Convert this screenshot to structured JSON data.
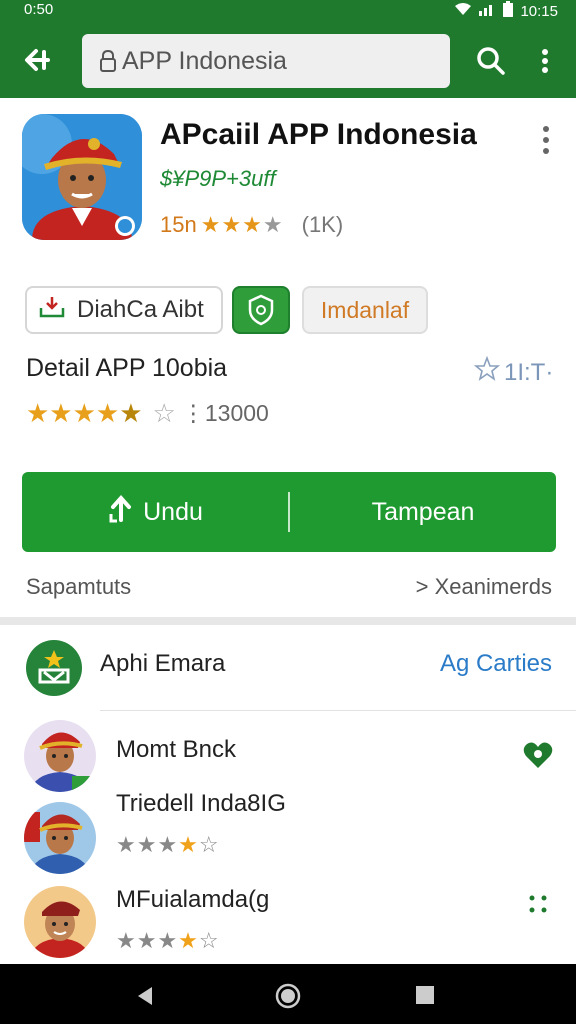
{
  "status_bar": {
    "time": "0:50",
    "right_text": "10:15"
  },
  "search": {
    "value": "APP Indonesia"
  },
  "app": {
    "title": "APcaiil APP Indonesia",
    "subtitle": "$¥P9P+3uff",
    "rating_prefix": "15n",
    "rating_count": "(1K)"
  },
  "chips": {
    "download_label": "DiahCa Aibt",
    "tag_label": "Imdanlaf"
  },
  "detail": {
    "title": "Detail APP 10obia",
    "side_label": "1I:T·",
    "count": "13000"
  },
  "buttons": {
    "download_label": "Undu",
    "other_label": "Tampean"
  },
  "row": {
    "left": "Sapamtuts",
    "right": "> Xeanimerds"
  },
  "section": {
    "title": "Aphi Emara",
    "link": "Ag Carties"
  },
  "items": [
    {
      "title": "Momt Bnck"
    },
    {
      "title": "Triedell Inda8IG"
    },
    {
      "title": "MFuialamda(g"
    }
  ],
  "colors": {
    "primary_green": "#1f7a2e",
    "button_green": "#1e9a30",
    "star_gold": "#e8a01c",
    "link_blue": "#2a7bc8"
  }
}
